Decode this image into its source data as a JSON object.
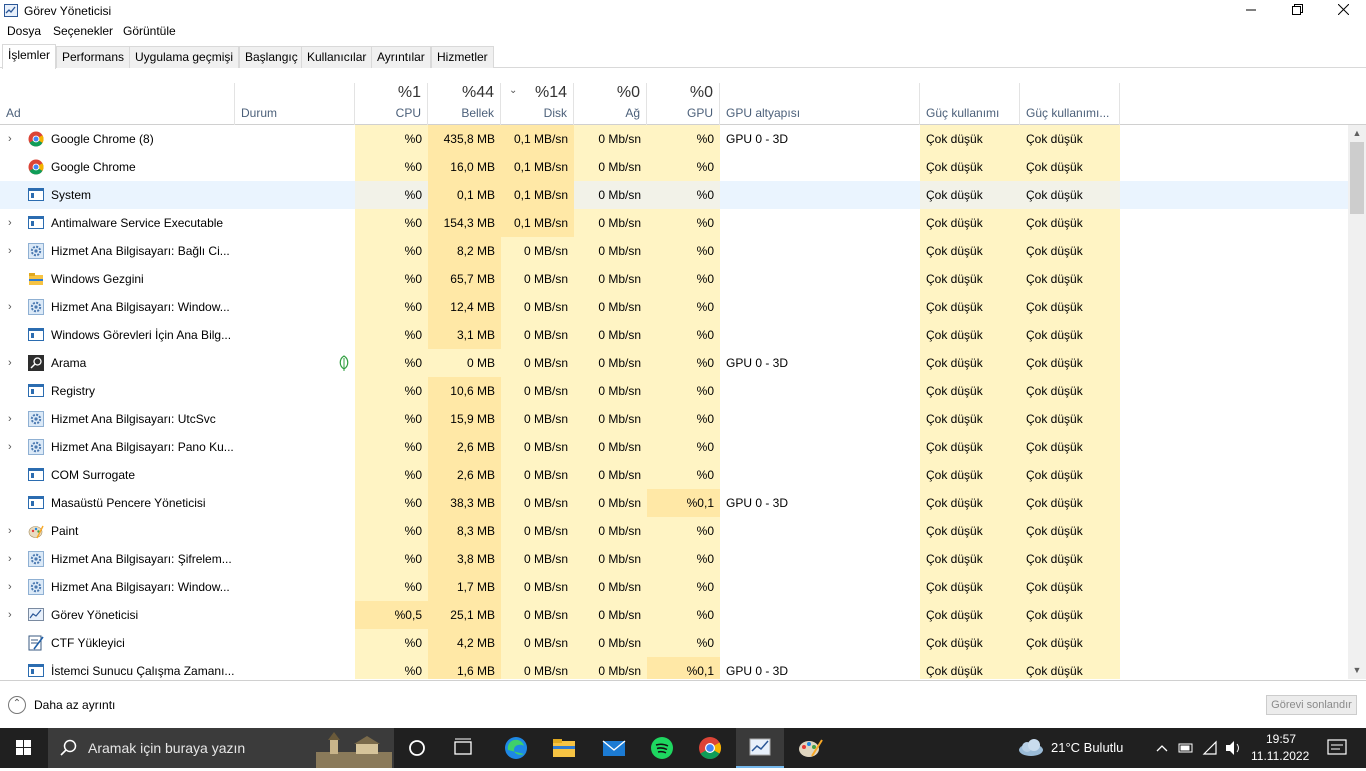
{
  "window": {
    "title": "Görev Yöneticisi"
  },
  "menu": [
    "Dosya",
    "Seçenekler",
    "Görüntüle"
  ],
  "tabs": [
    "İşlemler",
    "Performans",
    "Uygulama geçmişi",
    "Başlangıç",
    "Kullanıcılar",
    "Ayrıntılar",
    "Hizmetler"
  ],
  "active_tab": "İşlemler",
  "columns": {
    "name": "Ad",
    "status": "Durum",
    "cpu": {
      "pct": "%1",
      "label": "CPU"
    },
    "memory": {
      "pct": "%44",
      "label": "Bellek"
    },
    "disk": {
      "pct": "%14",
      "label": "Disk"
    },
    "network": {
      "pct": "%0",
      "label": "Ağ"
    },
    "gpu": {
      "pct": "%0",
      "label": "GPU"
    },
    "gpu_engine": "GPU altyapısı",
    "power": "Güç kullanımı",
    "power_trend": "Güç kullanımı..."
  },
  "processes": [
    {
      "name": "Google Chrome (8)",
      "icon": "chrome-icon",
      "expandable": true,
      "cpu": "%0",
      "memory": "435,8 MB",
      "disk": "0,1 MB/sn",
      "network": "0 Mb/sn",
      "gpu": "%0",
      "gpu_engine": "GPU 0 - 3D",
      "power": "Çok düşük",
      "power_trend": "Çok düşük"
    },
    {
      "name": "Google Chrome",
      "icon": "chrome-icon",
      "expandable": false,
      "cpu": "%0",
      "memory": "16,0 MB",
      "disk": "0,1 MB/sn",
      "network": "0 Mb/sn",
      "gpu": "%0",
      "gpu_engine": "",
      "power": "Çok düşük",
      "power_trend": "Çok düşük"
    },
    {
      "name": "System",
      "icon": "window-icon",
      "expandable": false,
      "cpu": "%0",
      "memory": "0,1 MB",
      "disk": "0,1 MB/sn",
      "network": "0 Mb/sn",
      "gpu": "%0",
      "gpu_engine": "",
      "power": "Çok düşük",
      "power_trend": "Çok düşük",
      "selected": true
    },
    {
      "name": "Antimalware Service Executable",
      "icon": "window-icon",
      "expandable": true,
      "cpu": "%0",
      "memory": "154,3 MB",
      "disk": "0,1 MB/sn",
      "network": "0 Mb/sn",
      "gpu": "%0",
      "gpu_engine": "",
      "power": "Çok düşük",
      "power_trend": "Çok düşük"
    },
    {
      "name": "Hizmet Ana Bilgisayarı: Bağlı Ci...",
      "icon": "gear-icon",
      "expandable": true,
      "cpu": "%0",
      "memory": "8,2 MB",
      "disk": "0 MB/sn",
      "network": "0 Mb/sn",
      "gpu": "%0",
      "gpu_engine": "",
      "power": "Çok düşük",
      "power_trend": "Çok düşük"
    },
    {
      "name": "Windows Gezgini",
      "icon": "folder-icon",
      "expandable": false,
      "cpu": "%0",
      "memory": "65,7 MB",
      "disk": "0 MB/sn",
      "network": "0 Mb/sn",
      "gpu": "%0",
      "gpu_engine": "",
      "power": "Çok düşük",
      "power_trend": "Çok düşük"
    },
    {
      "name": "Hizmet Ana Bilgisayarı: Window...",
      "icon": "gear-icon",
      "expandable": true,
      "cpu": "%0",
      "memory": "12,4 MB",
      "disk": "0 MB/sn",
      "network": "0 Mb/sn",
      "gpu": "%0",
      "gpu_engine": "",
      "power": "Çok düşük",
      "power_trend": "Çok düşük"
    },
    {
      "name": "Windows Görevleri İçin Ana Bilg...",
      "icon": "window-icon",
      "expandable": false,
      "cpu": "%0",
      "memory": "3,1 MB",
      "disk": "0 MB/sn",
      "network": "0 Mb/sn",
      "gpu": "%0",
      "gpu_engine": "",
      "power": "Çok düşük",
      "power_trend": "Çok düşük"
    },
    {
      "name": "Arama",
      "icon": "search-icon",
      "expandable": true,
      "cpu": "%0",
      "memory": "0 MB",
      "disk": "0 MB/sn",
      "network": "0 Mb/sn",
      "gpu": "%0",
      "gpu_engine": "GPU 0 - 3D",
      "power": "Çok düşük",
      "power_trend": "Çok düşük",
      "suspended": true
    },
    {
      "name": "Registry",
      "icon": "window-icon",
      "expandable": false,
      "cpu": "%0",
      "memory": "10,6 MB",
      "disk": "0 MB/sn",
      "network": "0 Mb/sn",
      "gpu": "%0",
      "gpu_engine": "",
      "power": "Çok düşük",
      "power_trend": "Çok düşük"
    },
    {
      "name": "Hizmet Ana Bilgisayarı: UtcSvc",
      "icon": "gear-icon",
      "expandable": true,
      "cpu": "%0",
      "memory": "15,9 MB",
      "disk": "0 MB/sn",
      "network": "0 Mb/sn",
      "gpu": "%0",
      "gpu_engine": "",
      "power": "Çok düşük",
      "power_trend": "Çok düşük"
    },
    {
      "name": "Hizmet Ana Bilgisayarı: Pano Ku...",
      "icon": "gear-icon",
      "expandable": true,
      "cpu": "%0",
      "memory": "2,6 MB",
      "disk": "0 MB/sn",
      "network": "0 Mb/sn",
      "gpu": "%0",
      "gpu_engine": "",
      "power": "Çok düşük",
      "power_trend": "Çok düşük"
    },
    {
      "name": "COM Surrogate",
      "icon": "window-icon",
      "expandable": false,
      "cpu": "%0",
      "memory": "2,6 MB",
      "disk": "0 MB/sn",
      "network": "0 Mb/sn",
      "gpu": "%0",
      "gpu_engine": "",
      "power": "Çok düşük",
      "power_trend": "Çok düşük"
    },
    {
      "name": "Masaüstü Pencere Yöneticisi",
      "icon": "window-icon",
      "expandable": false,
      "cpu": "%0",
      "memory": "38,3 MB",
      "disk": "0 MB/sn",
      "network": "0 Mb/sn",
      "gpu": "%0,1",
      "gpu_engine": "GPU 0 - 3D",
      "power": "Çok düşük",
      "power_trend": "Çok düşük"
    },
    {
      "name": "Paint",
      "icon": "paint-icon",
      "expandable": true,
      "cpu": "%0",
      "memory": "8,3 MB",
      "disk": "0 MB/sn",
      "network": "0 Mb/sn",
      "gpu": "%0",
      "gpu_engine": "",
      "power": "Çok düşük",
      "power_trend": "Çok düşük"
    },
    {
      "name": "Hizmet Ana Bilgisayarı: Şifrelem...",
      "icon": "gear-icon",
      "expandable": true,
      "cpu": "%0",
      "memory": "3,8 MB",
      "disk": "0 MB/sn",
      "network": "0 Mb/sn",
      "gpu": "%0",
      "gpu_engine": "",
      "power": "Çok düşük",
      "power_trend": "Çok düşük"
    },
    {
      "name": "Hizmet Ana Bilgisayarı: Window...",
      "icon": "gear-icon",
      "expandable": true,
      "cpu": "%0",
      "memory": "1,7 MB",
      "disk": "0 MB/sn",
      "network": "0 Mb/sn",
      "gpu": "%0",
      "gpu_engine": "",
      "power": "Çok düşük",
      "power_trend": "Çok düşük"
    },
    {
      "name": "Görev Yöneticisi",
      "icon": "task-manager-icon",
      "expandable": true,
      "cpu": "%0,5",
      "memory": "25,1 MB",
      "disk": "0 MB/sn",
      "network": "0 Mb/sn",
      "gpu": "%0",
      "gpu_engine": "",
      "power": "Çok düşük",
      "power_trend": "Çok düşük"
    },
    {
      "name": "CTF Yükleyici",
      "icon": "ctf-icon",
      "expandable": false,
      "cpu": "%0",
      "memory": "4,2 MB",
      "disk": "0 MB/sn",
      "network": "0 Mb/sn",
      "gpu": "%0",
      "gpu_engine": "",
      "power": "Çok düşük",
      "power_trend": "Çok düşük"
    },
    {
      "name": "İstemci Sunucu Çalışma Zamanı...",
      "icon": "window-icon",
      "expandable": false,
      "cpu": "%0",
      "memory": "1,6 MB",
      "disk": "0 MB/sn",
      "network": "0 Mb/sn",
      "gpu": "%0,1",
      "gpu_engine": "GPU 0 - 3D",
      "power": "Çok düşük",
      "power_trend": "Çok düşük"
    }
  ],
  "footer": {
    "less_details": "Daha az ayrıntı",
    "end_task": "Görevi sonlandır"
  },
  "taskbar": {
    "search_placeholder": "Aramak için buraya yazın",
    "weather": "21°C  Bulutlu",
    "time": "19:57",
    "date": "11.11.2022"
  },
  "colors": {
    "heat_low": "#fff4c4",
    "heat_med": "#ffe8a6",
    "selected_row": "#eaf4fe",
    "header_label": "#4c607a"
  }
}
